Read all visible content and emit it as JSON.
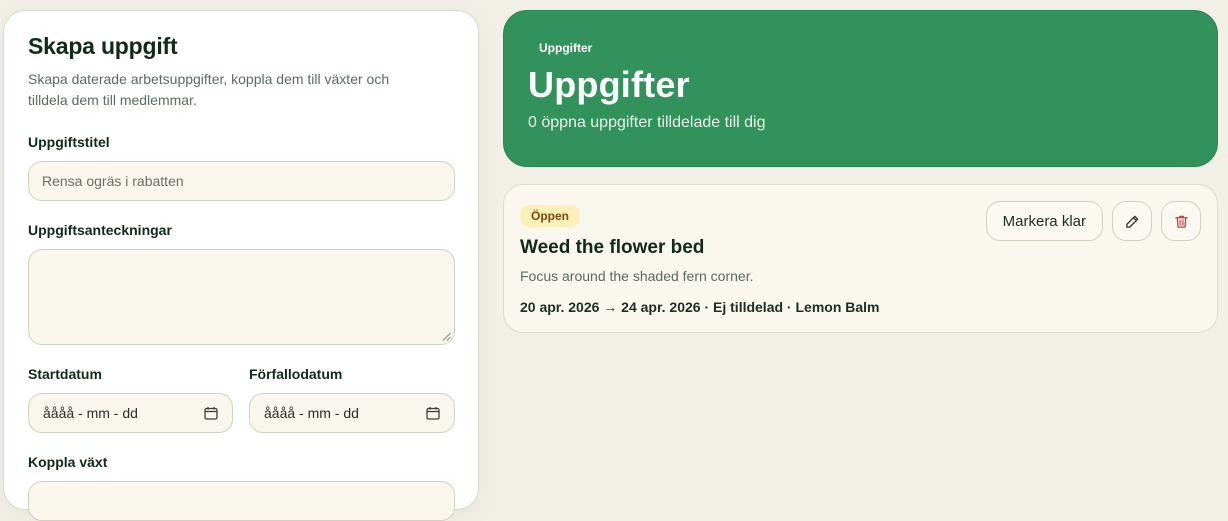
{
  "form": {
    "title": "Skapa uppgift",
    "description": "Skapa daterade arbetsuppgifter, koppla dem till växter och tilldela dem till medlemmar.",
    "task_title_label": "Uppgiftstitel",
    "task_title_placeholder": "Rensa ogräs i rabatten",
    "notes_label": "Uppgiftsanteckningar",
    "notes_value": "",
    "start_date_label": "Startdatum",
    "start_date_placeholder": "åååå - mm - dd",
    "due_date_label": "Förfallodatum",
    "due_date_placeholder": "åååå - mm - dd",
    "link_plant_label": "Koppla växt"
  },
  "hero": {
    "eyebrow": "Uppgifter",
    "title": "Uppgifter",
    "subtitle": "0 öppna uppgifter tilldelade till dig"
  },
  "tasks": [
    {
      "status": "Öppen",
      "title": "Weed the flower bed",
      "notes": "Focus around the shaded fern corner.",
      "meta": "20 apr. 2026 → 24 apr. 2026 · Ej tilldelad · Lemon Balm",
      "complete_label": "Markera klar",
      "edit_icon": "pencil-icon",
      "delete_icon": "trash-icon"
    }
  ],
  "colors": {
    "accent": "#32925b",
    "badge_bg": "#fcefb8",
    "danger": "#d23a3a"
  }
}
